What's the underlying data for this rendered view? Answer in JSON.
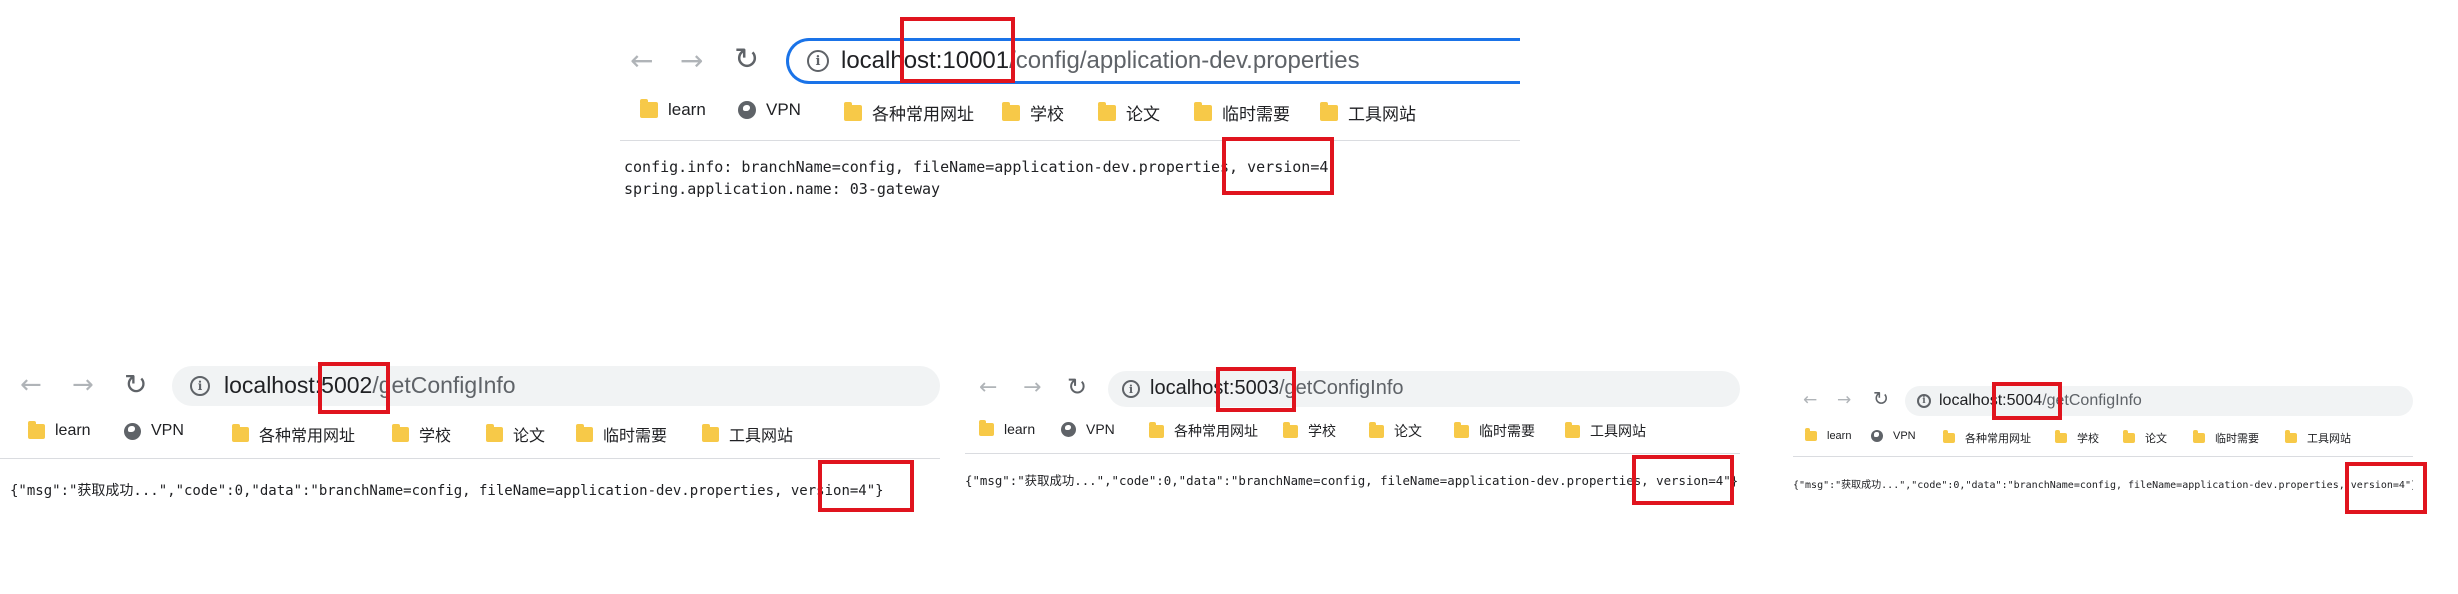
{
  "nav": {
    "back": "←",
    "forward": "→",
    "reload": "↻",
    "info": "i"
  },
  "bookmarks": [
    {
      "label": "learn",
      "icon": "folder-icon"
    },
    {
      "label": "VPN",
      "icon": "globe-icon"
    },
    {
      "label": "各种常用网址",
      "icon": "folder-icon"
    },
    {
      "label": "学校",
      "icon": "folder-icon"
    },
    {
      "label": "论文",
      "icon": "folder-icon"
    },
    {
      "label": "临时需要",
      "icon": "folder-icon"
    },
    {
      "label": "工具网站",
      "icon": "folder-icon"
    }
  ],
  "colors": {
    "highlight": "#e0141e",
    "folder": "#f7c948",
    "omnibox_focus": "#1a73e8"
  },
  "top": {
    "url_host": "localhost:10001",
    "url_path": "/config/application-dev.properties",
    "content_line1": "config.info: branchName=config, fileName=application-dev.properties, version=4",
    "content_line2": "spring.application.name: 03-gateway"
  },
  "window_5002": {
    "url_host": "localhost:5002",
    "url_path": "/getConfigInfo",
    "content": "{\"msg\":\"获取成功...\",\"code\":0,\"data\":\"branchName=config, fileName=application-dev.properties, version=4\"}"
  },
  "window_5003": {
    "url_host": "localhost:5003",
    "url_path": "/getConfigInfo",
    "content": "{\"msg\":\"获取成功...\",\"code\":0,\"data\":\"branchName=config, fileName=application-dev.properties, version=4\"}"
  },
  "window_5004": {
    "url_host": "localhost:5004",
    "url_path": "/getConfigInfo",
    "content": "{\"msg\":\"获取成功...\",\"code\":0,\"data\":\"branchName=config, fileName=application-dev.properties, version=4\"}"
  }
}
